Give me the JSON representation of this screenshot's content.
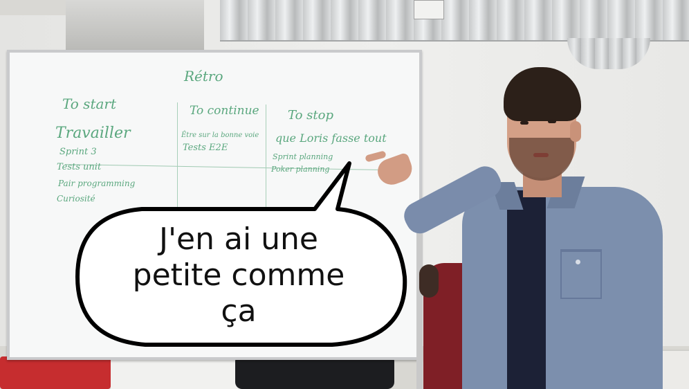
{
  "board": {
    "title": "Rétro",
    "columns": [
      {
        "heading": "To start",
        "items": [
          "Travailler",
          "Sprint 3",
          "Tests unit",
          "Pair programming",
          "Curiosité"
        ]
      },
      {
        "heading": "To continue",
        "items": [
          "Être sur la bonne voie",
          "Tests E2E"
        ]
      },
      {
        "heading": "To stop",
        "items": [
          "que Loris fasse tout",
          "Sprint planning",
          "Poker planning"
        ]
      }
    ]
  },
  "bubble": {
    "lines": [
      "J'en ai une",
      "petite comme",
      "ça"
    ]
  },
  "colors": {
    "ink": "#5aa77e",
    "bubble_fill": "#ffffff",
    "bubble_outline": "#000000",
    "shirt": "#7c8fad"
  }
}
